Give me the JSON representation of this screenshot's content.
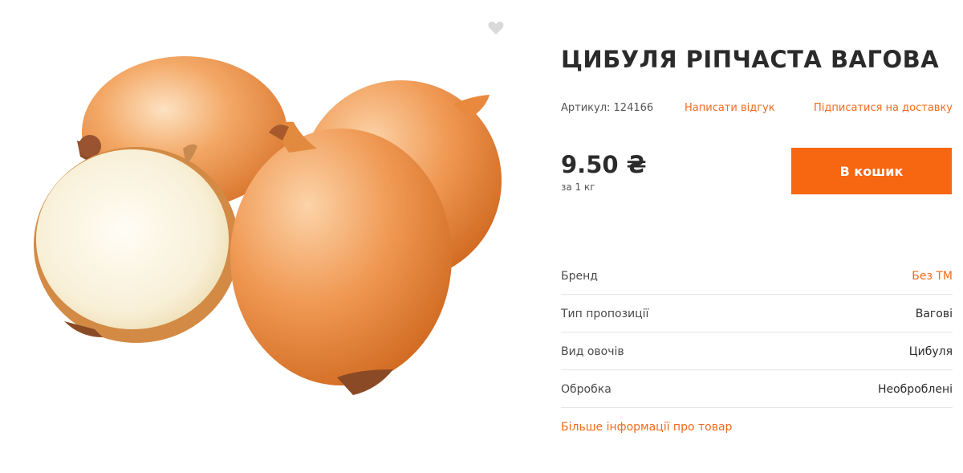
{
  "product": {
    "title": "ЦИБУЛЯ РІПЧАСТА ВАГОВА",
    "sku_label": "Артикул: 124166",
    "review_link": "Написати відгук",
    "subscribe_link": "Підписатися на доставку",
    "price": "9.50 ₴",
    "unit": "за 1 кг",
    "cart_button": "В кошик",
    "image_alt": "onion-image"
  },
  "specs": [
    {
      "key": "Бренд",
      "value": "Без ТМ"
    },
    {
      "key": "Тип пропозиції",
      "value": "Вагові"
    },
    {
      "key": "Вид овочів",
      "value": "Цибуля"
    },
    {
      "key": "Обробка",
      "value": "Необроблені"
    }
  ],
  "more_info_link": "Більше інформації про товар",
  "colors": {
    "accent": "#f76611",
    "link": "#f26a1b",
    "text": "#2b2b2b"
  },
  "icons": {
    "favorite": "heart-icon"
  }
}
